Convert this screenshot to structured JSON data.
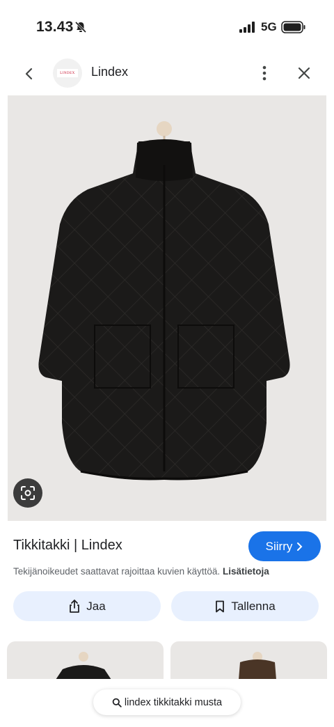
{
  "status_bar": {
    "time": "13.43",
    "network": "5G"
  },
  "header": {
    "logo_text": "LINDEX",
    "site_name": "Lindex"
  },
  "result": {
    "title": "Tikkitakki | Lindex",
    "visit_label": "Siirry",
    "copyright_text": "Tekijänoikeudet saattavat rajoittaa kuvien käyttöä.",
    "learn_more": "Lisätietoja"
  },
  "actions": {
    "share_label": "Jaa",
    "save_label": "Tallenna"
  },
  "search": {
    "query": "lindex tikkitakki musta"
  },
  "colors": {
    "accent": "#1a73e8",
    "action_bg": "#e8f0fe",
    "image_bg": "#e9e7e5",
    "jacket": "#1b1a19",
    "brand_red": "#c8102e"
  },
  "icons": {
    "back": "arrow-left-icon",
    "more": "more-vert-icon",
    "close": "close-icon",
    "lens": "lens-icon",
    "share": "share-icon",
    "save": "bookmark-icon",
    "search": "search-icon"
  }
}
